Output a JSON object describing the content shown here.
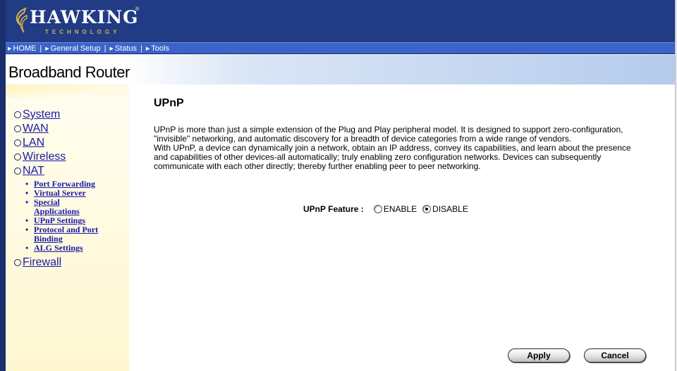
{
  "logo": {
    "main": "HAWKING",
    "registered": "®",
    "sub": "TECHNOLOGY"
  },
  "nav": {
    "items": [
      {
        "label": "HOME"
      },
      {
        "label": "General Setup"
      },
      {
        "label": "Status"
      },
      {
        "label": "Tools"
      }
    ]
  },
  "header": {
    "title": "Broadband Router"
  },
  "sidebar": {
    "items": [
      {
        "label": "System"
      },
      {
        "label": "WAN"
      },
      {
        "label": "LAN"
      },
      {
        "label": "Wireless"
      },
      {
        "label": "NAT"
      },
      {
        "label": "Firewall"
      }
    ],
    "nat_submenu": [
      {
        "label": "Port Forwarding"
      },
      {
        "label": "Virtual Server"
      },
      {
        "label": "Special Applications"
      },
      {
        "label": "UPnP Settings"
      },
      {
        "label": "Protocol and Port Binding"
      },
      {
        "label": "ALG Settings"
      }
    ]
  },
  "main": {
    "title": "UPnP",
    "description_lines": [
      "UPnP is more than just a simple extension of the Plug and Play peripheral model. It is designed to support zero-configuration,",
      "\"invisible\" networking, and automatic discovery for a breadth of device categories from a wide range of vendors.",
      "With UPnP, a device can dynamically join a network, obtain an IP address, convey its capabilities, and learn about the presence",
      "and capabilities of other devices-all automatically; truly enabling zero configuration networks. Devices can subsequently",
      "communicate with each other directly; thereby further enabling peer to peer networking."
    ],
    "feature": {
      "label": "UPnP Feature :",
      "options": [
        {
          "label": "ENABLE",
          "checked": false
        },
        {
          "label": "DISABLE",
          "checked": true
        }
      ]
    }
  },
  "buttons": {
    "apply": "Apply",
    "cancel": "Cancel"
  },
  "colors": {
    "header_bg": "#213b84",
    "navbar_bg": "#3b63c8",
    "link": "#1a1aa6",
    "sidebar_bg": "#fff7d0"
  }
}
